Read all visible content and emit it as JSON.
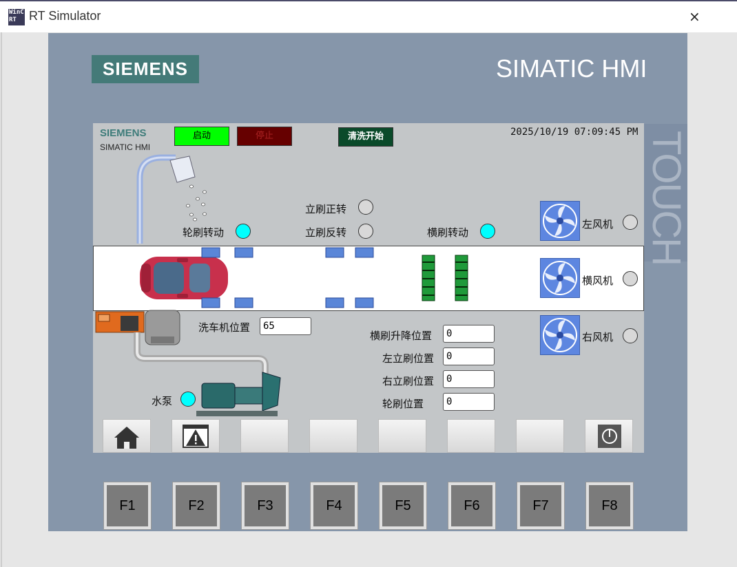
{
  "window": {
    "title": "RT Simulator",
    "icon_text_top": "WinC",
    "icon_text_bottom": "RT",
    "close_symbol": "×"
  },
  "device": {
    "brand": "SIEMENS",
    "model": "SIMATIC HMI",
    "touch": "TOUCH"
  },
  "screen": {
    "brand": "SIEMENS",
    "model": "SIMATIC HMI",
    "start_label": "启动",
    "stop_label": "停止",
    "wash_label": "清洗开始",
    "datetime": "2025/10/19 07:09:45 PM",
    "indicators": {
      "vertical_forward": "立刷正转",
      "vertical_reverse": "立刷反转",
      "wheel_brush_rotate": "轮刷转动",
      "horizontal_brush_rotate": "横刷转动",
      "left_fan": "左风机",
      "horizontal_fan": "横风机",
      "right_fan": "右风机",
      "pump": "水泵"
    },
    "fields": {
      "washer_position_label": "洗车机位置",
      "washer_position_value": "65",
      "hbrush_lift_label": "横刷升降位置",
      "hbrush_lift_value": "0",
      "left_vbrush_label": "左立刷位置",
      "left_vbrush_value": "0",
      "right_vbrush_label": "右立刷位置",
      "right_vbrush_value": "0",
      "wheel_brush_label": "轮刷位置",
      "wheel_brush_value": "0"
    },
    "softkeys": [
      "home-icon",
      "alarm-icon",
      "",
      "",
      "",
      "",
      "",
      "power-icon"
    ]
  },
  "fkeys": [
    "F1",
    "F2",
    "F3",
    "F4",
    "F5",
    "F6",
    "F7",
    "F8"
  ],
  "colors": {
    "lamp_on": "#00ffff",
    "lamp_off": "#d8d8d8",
    "start": "#00ff00",
    "stop": "#660000",
    "brand": "#447a78"
  }
}
